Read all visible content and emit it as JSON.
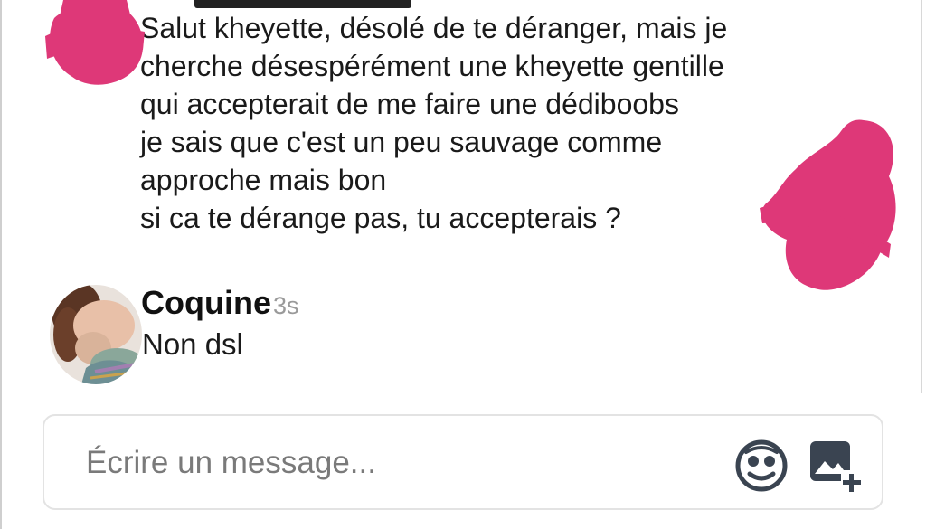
{
  "thread": {
    "first_message": {
      "lines": [
        "Salut kheyette, désolé de te déranger, mais je",
        "cherche désespérément une kheyette gentille",
        "qui accepterait de me faire une dédiboobs",
        "je sais que c'est un peu sauvage comme",
        "approche mais bon",
        "si ca te dérange pas, tu accepterais ?"
      ]
    },
    "reply": {
      "sender": "Coquine",
      "time": "3s",
      "text": "Non dsl"
    }
  },
  "composer": {
    "placeholder": "Écrire un message...",
    "emoji_icon": "emoji-icon",
    "image_icon": "add-image-icon"
  },
  "colors": {
    "redaction": "#de3878",
    "time_gray": "#9a9a9a",
    "icon_dark": "#3a4451"
  }
}
